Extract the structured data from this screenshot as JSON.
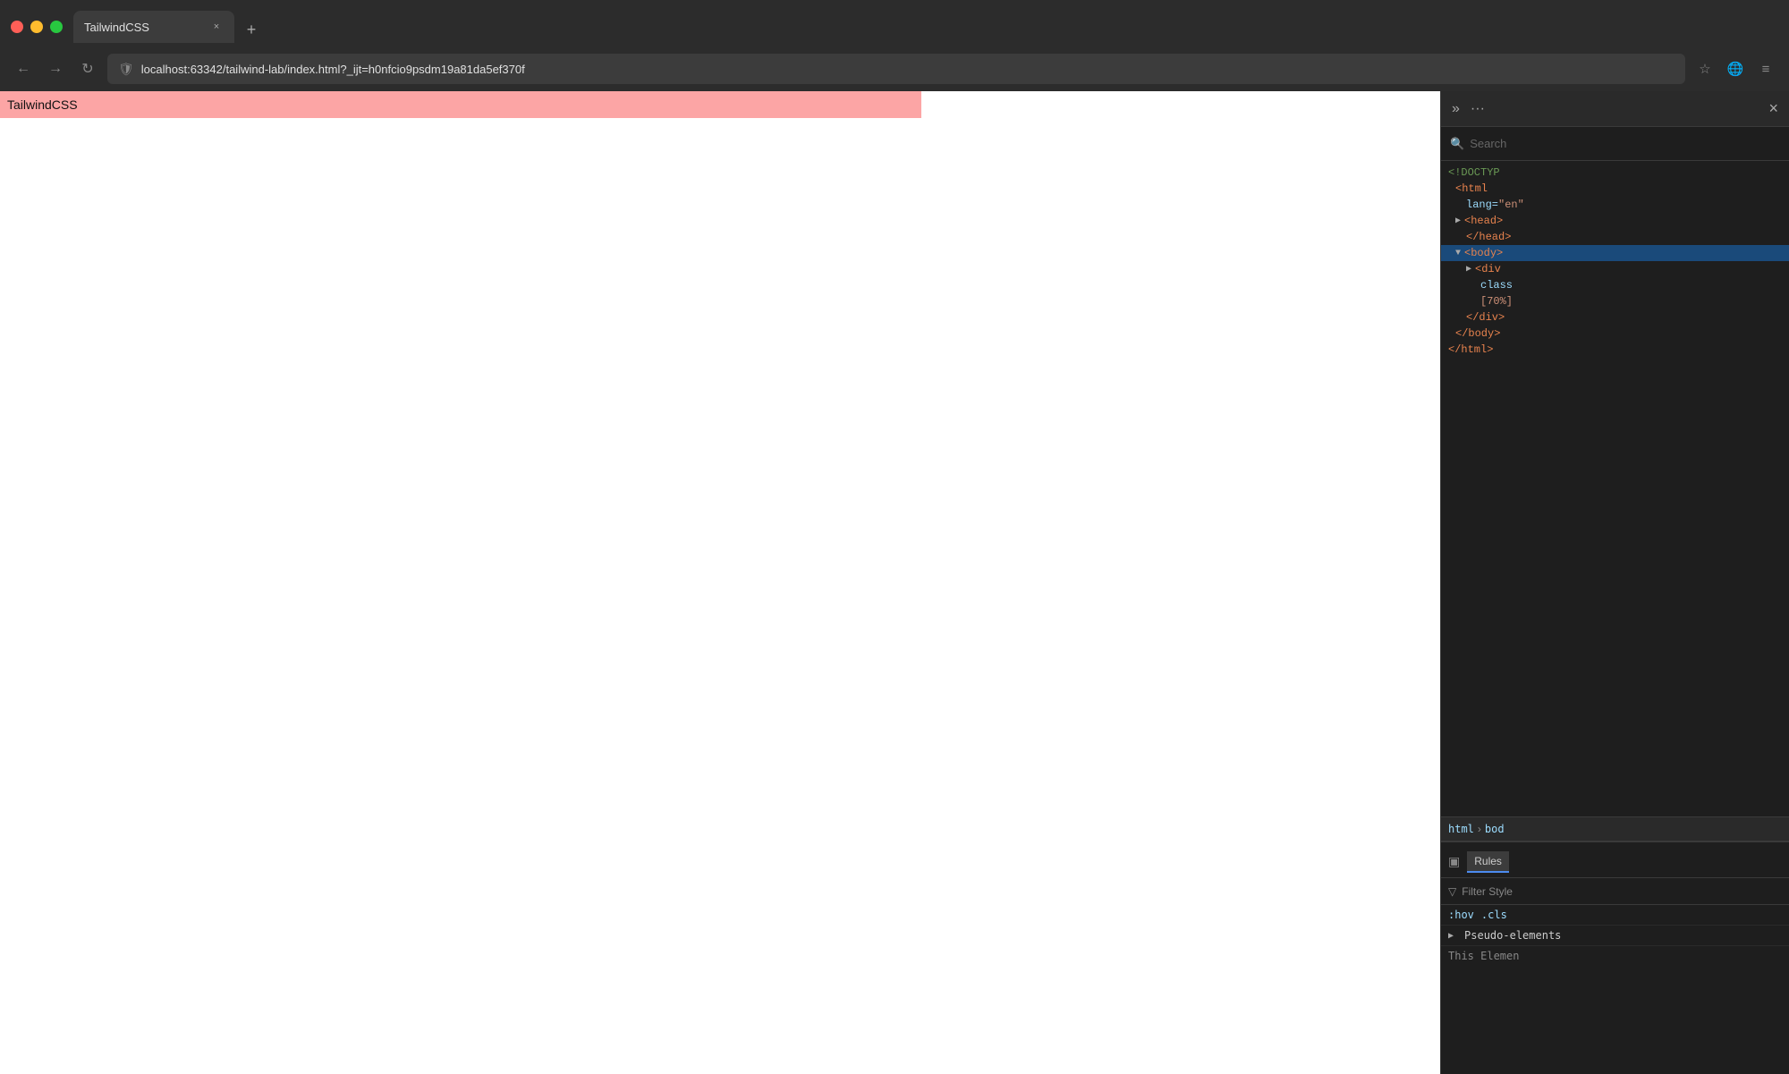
{
  "browser": {
    "tab": {
      "title": "TailwindCSS",
      "close_label": "×"
    },
    "new_tab_label": "+",
    "address_bar": {
      "url": "localhost:63342/tailwind-lab/index.html?_ijt=h0nfcio9psdm19a81da5ef370f",
      "shield_icon": "🛡",
      "bookmark_icon": "☆"
    },
    "nav": {
      "back": "←",
      "forward": "→",
      "refresh": "↻"
    },
    "browser_icon": "🌐",
    "menu_icon": "≡"
  },
  "page": {
    "banner_text": "TailwindCSS",
    "banner_bg": "#fca5a5"
  },
  "devtools": {
    "toolbar": {
      "expand_icon": "»",
      "more_icon": "···",
      "close_icon": "×"
    },
    "search": {
      "placeholder": "Search",
      "icon": "🔍"
    },
    "dom_lines": [
      {
        "indent": 0,
        "content": "<!DOCTYPE"
      },
      {
        "indent": 1,
        "content": "<html"
      },
      {
        "indent": 2,
        "content": "lang=\"en\""
      },
      {
        "indent": 1,
        "content": "▶ <head>"
      },
      {
        "indent": 2,
        "content": "</head>"
      },
      {
        "indent": 1,
        "selected": true,
        "content": "▼ <body>"
      },
      {
        "indent": 2,
        "content": "▶ <div"
      },
      {
        "indent": 3,
        "content": "class"
      },
      {
        "indent": 3,
        "content": "[70%]"
      },
      {
        "indent": 2,
        "content": "</div>"
      },
      {
        "indent": 1,
        "content": "</body>"
      },
      {
        "indent": 0,
        "content": "</html>"
      }
    ],
    "breadcrumb": {
      "items": [
        "html",
        "bod"
      ]
    },
    "styles": {
      "rules_label": "Rules",
      "filter_label": "Filter Style",
      "pseudo_items": [
        ":hov",
        ".cls"
      ],
      "pseudo_label": "Pseudo-elements",
      "this_element_label": "This Elemen"
    }
  }
}
